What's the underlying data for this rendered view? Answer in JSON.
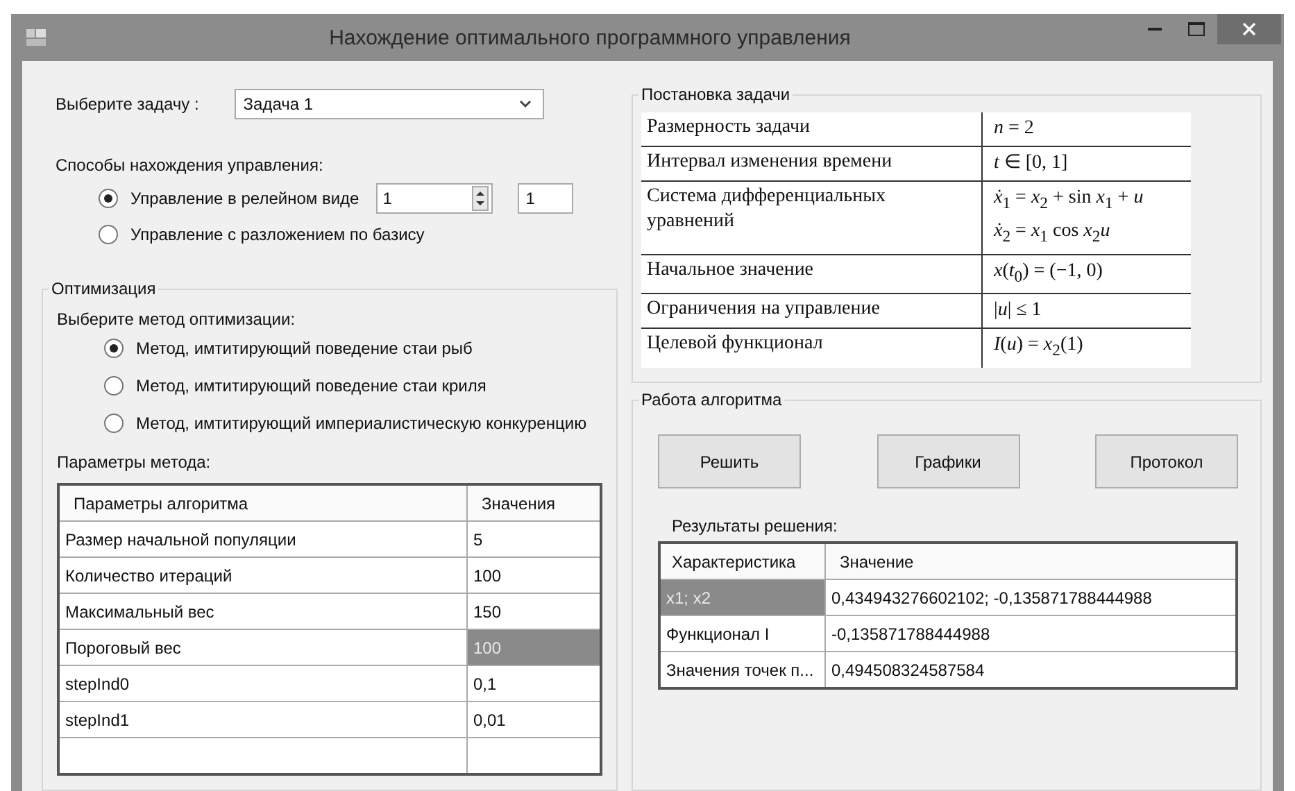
{
  "window": {
    "title": "Нахождение оптимального программного управления"
  },
  "task": {
    "label": "Выберите задачу :",
    "value": "Задача 1"
  },
  "control_methods": {
    "label": "Способы нахождения управления:",
    "options": [
      {
        "label": "Управление в релейном виде",
        "selected": true,
        "kind": "spinner",
        "spin_value": "1",
        "box_value": "1"
      },
      {
        "label": "Управление с разложением по базису",
        "selected": false,
        "kind": "plain"
      }
    ]
  },
  "optimization": {
    "title": "Оптимизация",
    "method_label": "Выберите метод оптимизации:",
    "methods": [
      {
        "label": "Метод, имтитирующий поведение стаи рыб",
        "selected": true
      },
      {
        "label": "Метод, имтитирующий поведение стаи криля",
        "selected": false
      },
      {
        "label": "Метод, имтитирующий империалистическую конкуренцию",
        "selected": false
      }
    ],
    "params_label": "Параметры метода:",
    "params_table": {
      "columns": [
        "Параметры алгоритма",
        "Значения"
      ],
      "rows": [
        {
          "cells": [
            {
              "text": "Размер начальной популяции",
              "selected": false
            },
            {
              "text": "5",
              "selected": false
            }
          ]
        },
        {
          "cells": [
            {
              "text": "Количество итераций",
              "selected": false
            },
            {
              "text": "100",
              "selected": false
            }
          ]
        },
        {
          "cells": [
            {
              "text": "Максимальный вес",
              "selected": false
            },
            {
              "text": "150",
              "selected": false
            }
          ]
        },
        {
          "cells": [
            {
              "text": "Пороговый вес",
              "selected": false
            },
            {
              "text": "100",
              "selected": true
            }
          ]
        },
        {
          "cells": [
            {
              "text": "stepInd0",
              "selected": false
            },
            {
              "text": "0,1",
              "selected": false
            }
          ]
        },
        {
          "cells": [
            {
              "text": "stepInd1",
              "selected": false
            },
            {
              "text": "0,01",
              "selected": false
            }
          ]
        }
      ]
    }
  },
  "problem": {
    "title": "Постановка задачи",
    "rows": [
      {
        "name": "Размерность задачи",
        "value": [
          "*n* = 2"
        ]
      },
      {
        "name": "Интервал изменения времени",
        "value": [
          "*t* ∈ [0, 1]"
        ]
      },
      {
        "name": "Система дифференциальных уравнений",
        "value": [
          "*ẋ*$_{1}$ = *x*$_{2}$ + sin *x*$_{1}$ + *u*",
          "*ẋ*$_{2}$ = *x*$_{1}$ cos *x*$_{2}$*u*"
        ]
      },
      {
        "name": "Начальное значение",
        "value": [
          "*x*(*t*$_{0}$) = (−1, 0)"
        ]
      },
      {
        "name": "Ограничения на управление",
        "value": [
          "|*u*| ≤ 1"
        ]
      },
      {
        "name": "Целевой функционал",
        "value": [
          "*I*(*u*) = *x*$_{2}$(1)"
        ]
      }
    ]
  },
  "algorithm": {
    "title": "Работа алгоритма",
    "buttons": [
      "Решить",
      "Графики",
      "Протокол"
    ],
    "results_label": "Результаты решения:",
    "results_table": {
      "columns": [
        "Характеристика",
        "Значение"
      ],
      "rows": [
        {
          "cells": [
            {
              "text": "x1; x2",
              "selected": true
            },
            {
              "text": "0,434943276602102; -0,135871788444988",
              "selected": false
            }
          ]
        },
        {
          "cells": [
            {
              "text": "Функционал I",
              "selected": false
            },
            {
              "text": "-0,135871788444988",
              "selected": false
            }
          ]
        },
        {
          "cells": [
            {
              "text": "Значения точек п...",
              "selected": false
            },
            {
              "text": "0,494508324587584",
              "selected": false
            }
          ]
        }
      ]
    }
  }
}
